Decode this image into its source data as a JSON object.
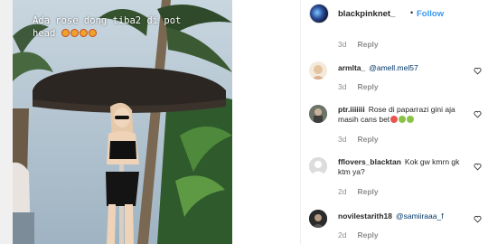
{
  "media": {
    "caption": "Ada rose dong tiba2 di pot head",
    "caption_emoji_count": 4
  },
  "post": {
    "username": "blackpinknet_",
    "separator": "•",
    "follow_label": "Follow",
    "first_meta": {
      "time": "3d",
      "reply": "Reply"
    }
  },
  "comments": [
    {
      "user": "armlta_",
      "text": "@amell.mel57",
      "mention": true,
      "time": "3d",
      "reply": "Reply"
    },
    {
      "user": "ptr.iiiiiii",
      "text": "Rose di paparrazi gini aja masih cans bet",
      "emojis": [
        "#e8554e",
        "#8bc34a",
        "#8bc34a"
      ],
      "mention": false,
      "time": "3d",
      "reply": "Reply"
    },
    {
      "user": "fflovers_blacktan",
      "text": "Kok gw kmrn gk ktm ya?",
      "mention": false,
      "time": "2d",
      "reply": "Reply"
    },
    {
      "user": "novilestarith18",
      "text": "@samiiraaa_f",
      "mention": true,
      "time": "2d",
      "reply": "Reply"
    }
  ],
  "colors": {
    "link": "#3897f0",
    "muted": "#8e8e8e",
    "text": "#262626",
    "mention": "#003569"
  },
  "icons": {
    "like": "heart-outline-icon"
  }
}
